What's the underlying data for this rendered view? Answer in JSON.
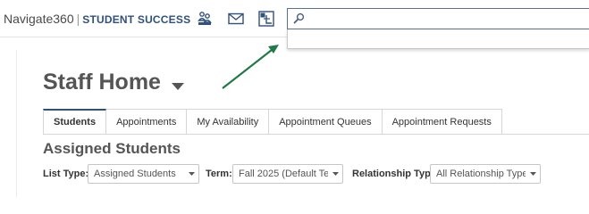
{
  "app": {
    "brand_name": "Navigate360",
    "brand_separator": "|",
    "brand_subtitle": "STUDENT SUCCESS"
  },
  "topbar": {
    "icons": [
      "people-icon",
      "mail-icon",
      "layout-icon"
    ]
  },
  "search": {
    "value": "",
    "placeholder": ""
  },
  "page": {
    "title": "Staff Home"
  },
  "tabs": [
    {
      "label": "Students",
      "active": true
    },
    {
      "label": "Appointments",
      "active": false
    },
    {
      "label": "My Availability",
      "active": false
    },
    {
      "label": "Appointment Queues",
      "active": false
    },
    {
      "label": "Appointment Requests",
      "active": false
    }
  ],
  "section": {
    "title": "Assigned Students"
  },
  "filters": {
    "list_type_label": "List Type:",
    "list_type_value": "Assigned Students",
    "term_label": "Term:",
    "term_value": "Fall 2025 (Default Te...",
    "relationship_label": "Relationship Type:",
    "relationship_value": "All Relationship Types"
  },
  "colors": {
    "brand_blue": "#31507a",
    "annotation_arrow": "#1f7a47",
    "search_border": "#5a6f94"
  }
}
